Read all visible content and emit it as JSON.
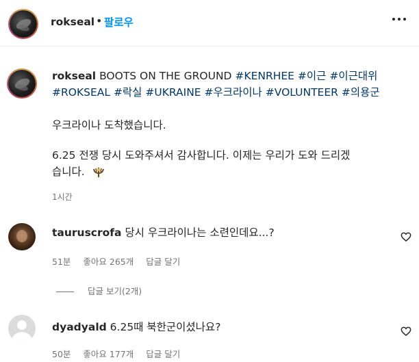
{
  "header": {
    "username": "rokseal",
    "dot": "•",
    "follow_label": "팔로우"
  },
  "caption": {
    "username": "rokseal",
    "line1_text": "BOOTS ON THE GROUND",
    "tags_line1": [
      "#KENRHEE",
      "#이근",
      "#이근대위"
    ],
    "tags_line2": [
      "#ROKSEAL",
      "#락실",
      "#UKRAINE",
      "#우크라이나",
      "#VOLUNTEER",
      "#의용군"
    ],
    "paragraph1": "우크라이나 도착했습니다.",
    "paragraph2_line1": "6.25 전쟁 당시 도와주셔서 감사합니다. 이제는 우리가 도와 드리겠",
    "paragraph2_line2": "습니다.",
    "time": "1시간"
  },
  "comments": [
    {
      "username": "tauruscrofa",
      "text": "당시 우크라이나는 소련인데요...?",
      "time": "51분",
      "likes": "좋아요 265개",
      "reply": "답글 달기",
      "view_replies": "답글 보기(2개)"
    },
    {
      "username": "dyadyald",
      "text": "6.25때 북한군이셨나요?",
      "time": "50분",
      "likes": "좋아요 177개",
      "reply": "답글 달기"
    }
  ],
  "icons": {
    "more": "more-horizontal-icon",
    "heart": "heart-outline-icon",
    "emoji": "trident-emoji-icon"
  },
  "colors": {
    "link": "#0095f6",
    "hashtag": "#00376b",
    "meta": "#737373"
  }
}
